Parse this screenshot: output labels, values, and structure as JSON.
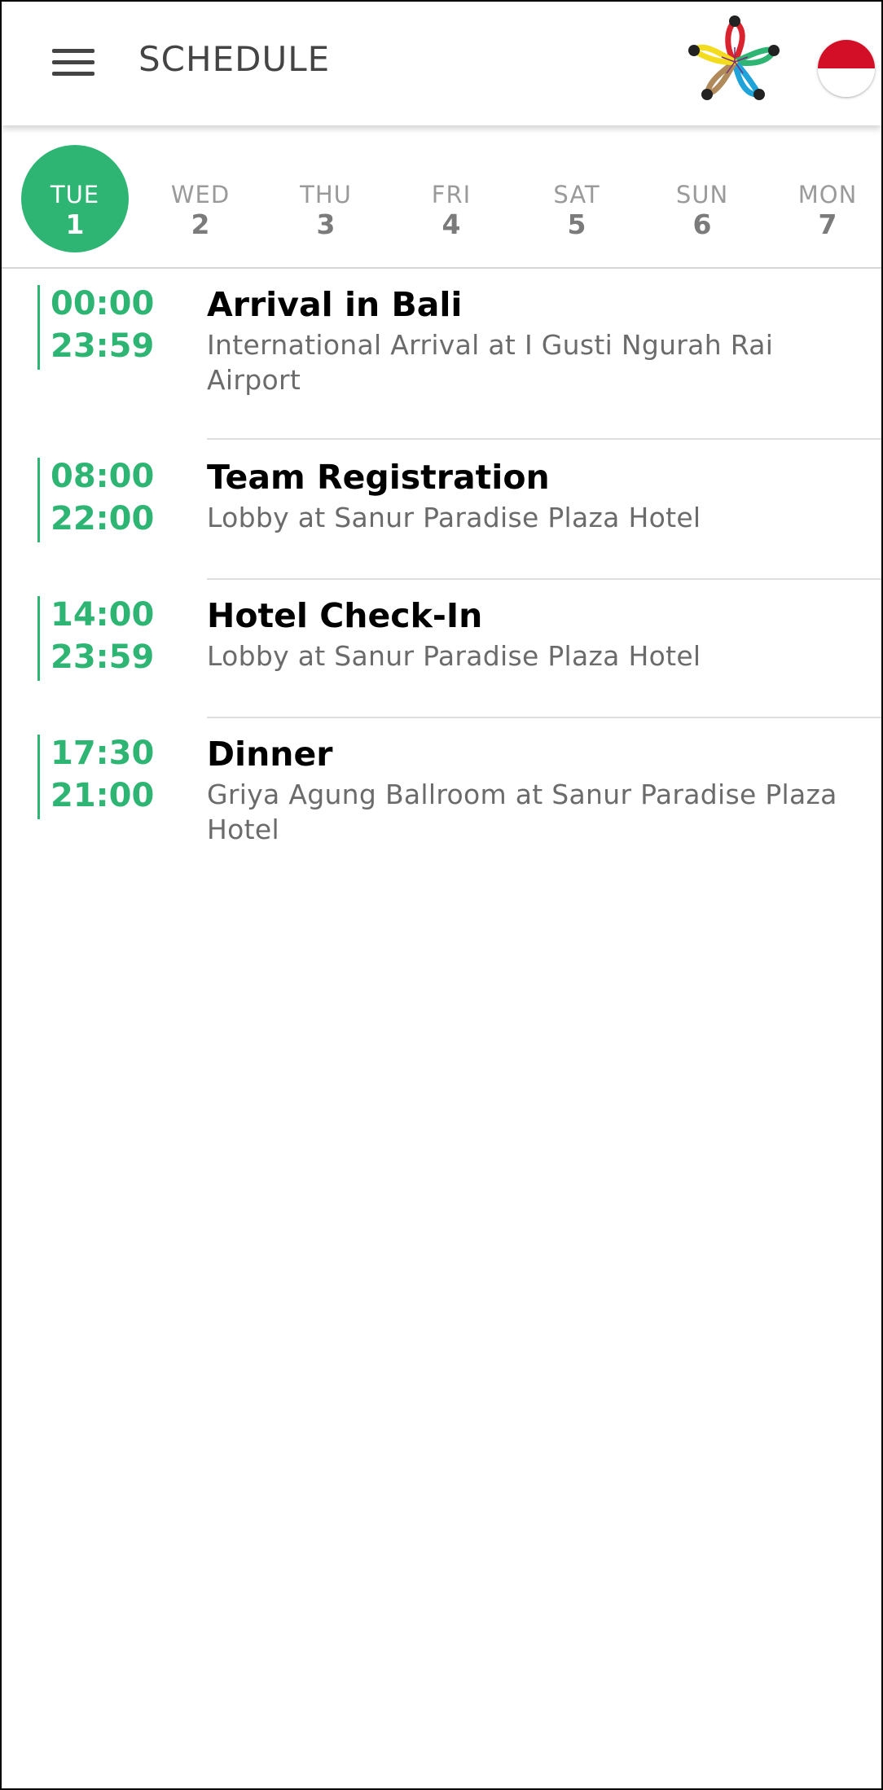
{
  "header": {
    "title": "SCHEDULE",
    "menu_icon": "hamburger-menu-icon",
    "logo_icon": "flower-logo-icon",
    "language_flag": "indonesia-flag-icon"
  },
  "days": [
    {
      "name": "TUE",
      "num": "1",
      "active": true
    },
    {
      "name": "WED",
      "num": "2",
      "active": false
    },
    {
      "name": "THU",
      "num": "3",
      "active": false
    },
    {
      "name": "FRI",
      "num": "4",
      "active": false
    },
    {
      "name": "SAT",
      "num": "5",
      "active": false
    },
    {
      "name": "SUN",
      "num": "6",
      "active": false
    },
    {
      "name": "MON",
      "num": "7",
      "active": false
    }
  ],
  "events": [
    {
      "start": "00:00",
      "end": "23:59",
      "title": "Arrival in Bali",
      "location": "International Arrival at I Gusti Ngurah Rai Airport"
    },
    {
      "start": "08:00",
      "end": "22:00",
      "title": "Team Registration",
      "location": "Lobby at Sanur Paradise Plaza Hotel"
    },
    {
      "start": "14:00",
      "end": "23:59",
      "title": "Hotel Check-In",
      "location": "Lobby at Sanur Paradise Plaza Hotel"
    },
    {
      "start": "17:30",
      "end": "21:00",
      "title": "Dinner",
      "location": "Griya Agung Ballroom at Sanur Paradise Plaza Hotel"
    }
  ],
  "colors": {
    "accent": "#2fb573",
    "flag_red": "#d20f26"
  }
}
